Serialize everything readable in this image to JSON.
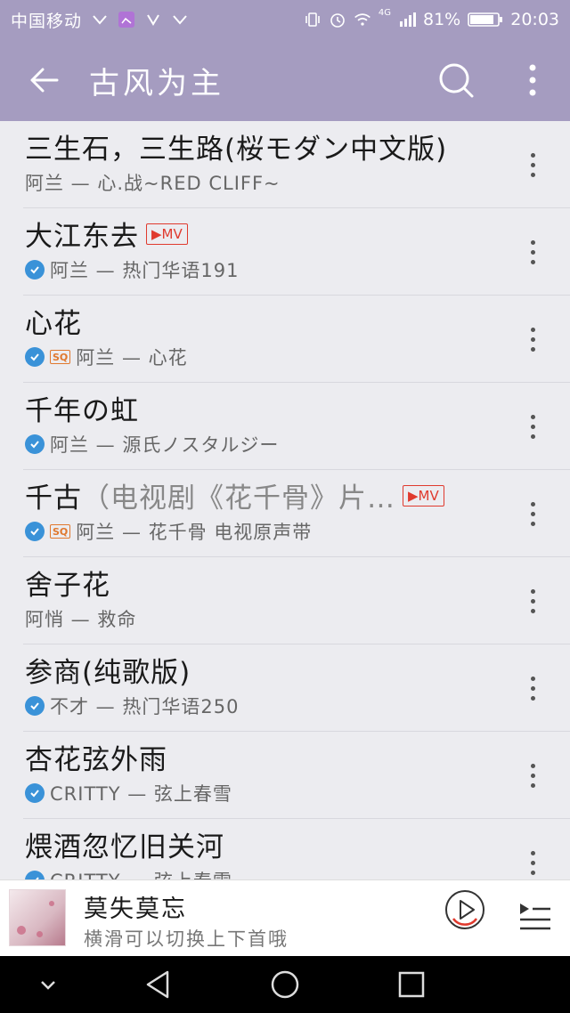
{
  "status_bar": {
    "carrier": "中国移动",
    "network": "4G",
    "battery": "81%",
    "time": "20:03"
  },
  "app_bar": {
    "title": "古风为主",
    "back_icon": "arrow-left-icon",
    "search_icon": "search-icon",
    "more_icon": "more-vert-icon"
  },
  "songs": [
    {
      "title": "三生石，三生路(桜モダン中文版)",
      "title_suffix": "",
      "mv": false,
      "downloaded": false,
      "sq": false,
      "subtitle": "阿兰 — 心.战~RED CLIFF~"
    },
    {
      "title": "大江东去",
      "title_suffix": "",
      "mv": true,
      "downloaded": true,
      "sq": false,
      "subtitle": "阿兰 — 热门华语191"
    },
    {
      "title": "心花",
      "title_suffix": "",
      "mv": false,
      "downloaded": true,
      "sq": true,
      "subtitle": "阿兰 — 心花"
    },
    {
      "title": "千年の虹",
      "title_suffix": "",
      "mv": false,
      "downloaded": true,
      "sq": false,
      "subtitle": "阿兰 — 源氏ノスタルジー"
    },
    {
      "title": "千古",
      "title_suffix": "（电视剧《花千骨》片…",
      "mv": true,
      "downloaded": true,
      "sq": true,
      "subtitle": "阿兰 — 花千骨 电视原声带"
    },
    {
      "title": "舍子花",
      "title_suffix": "",
      "mv": false,
      "downloaded": false,
      "sq": false,
      "subtitle": "阿悄 — 救命"
    },
    {
      "title": "参商(纯歌版)",
      "title_suffix": "",
      "mv": false,
      "downloaded": true,
      "sq": false,
      "subtitle": "不才 —  热门华语250"
    },
    {
      "title": "杏花弦外雨",
      "title_suffix": "",
      "mv": false,
      "downloaded": true,
      "sq": false,
      "subtitle": "CRITTY — 弦上春雪"
    },
    {
      "title": "煨酒忽忆旧关河",
      "title_suffix": "",
      "mv": false,
      "downloaded": true,
      "sq": false,
      "subtitle": "CRITTY — 弦上春雪"
    }
  ],
  "badges": {
    "mv": "▶MV",
    "sq": "SQ"
  },
  "player": {
    "title": "莫失莫忘",
    "subtitle": "横滑可以切换上下首哦",
    "play_icon": "play-circle-icon",
    "queue_icon": "queue-list-icon"
  },
  "nav_bar": {
    "icons": [
      "chevron-down-icon",
      "back-triangle-icon",
      "home-circle-icon",
      "recents-square-icon"
    ]
  },
  "colors": {
    "accent_bar": "#a59cc0",
    "mv_red": "#e03a2e",
    "check_blue": "#3a92d8",
    "sq_orange": "#e0782e"
  }
}
